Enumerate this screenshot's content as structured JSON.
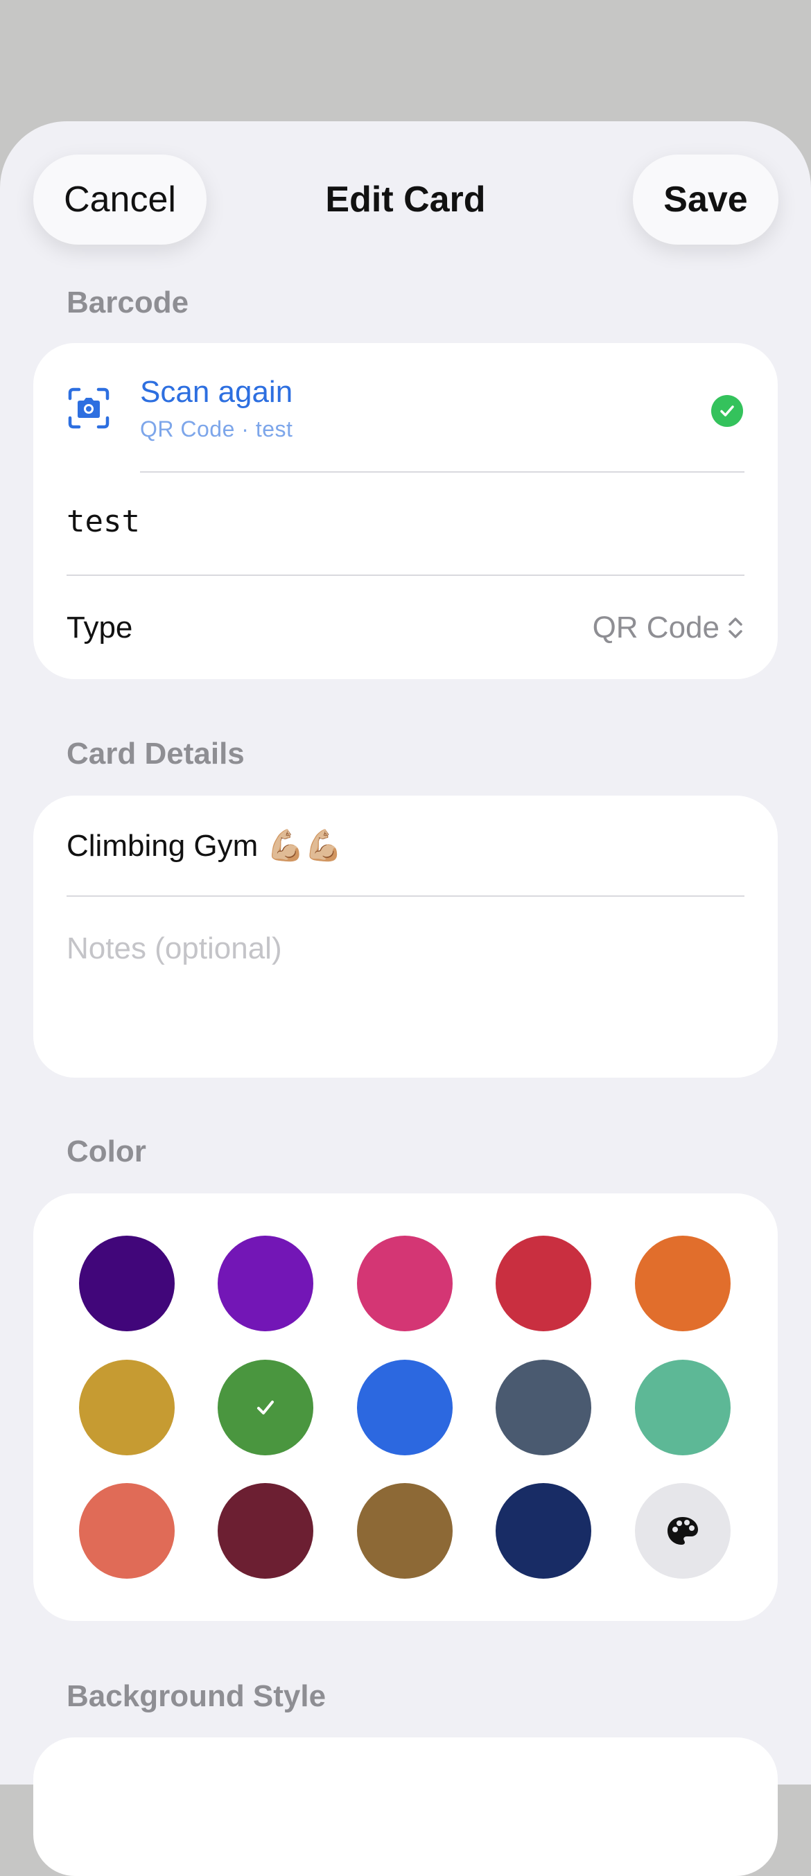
{
  "header": {
    "cancel_label": "Cancel",
    "title": "Edit Card",
    "save_label": "Save"
  },
  "barcode": {
    "section_label": "Barcode",
    "scan_label": "Scan again",
    "scan_subtitle": "QR Code · test",
    "value": "test",
    "type_label": "Type",
    "type_value": "QR Code"
  },
  "details": {
    "section_label": "Card Details",
    "name": "Climbing Gym 💪🏼💪🏼",
    "notes_placeholder": "Notes (optional)"
  },
  "color": {
    "section_label": "Color",
    "swatches": [
      {
        "hex": "#41067a"
      },
      {
        "hex": "#7316b6"
      },
      {
        "hex": "#d43674"
      },
      {
        "hex": "#c92f40"
      },
      {
        "hex": "#e16e2c"
      },
      {
        "hex": "#c69b32"
      },
      {
        "hex": "#4a963f",
        "selected": true
      },
      {
        "hex": "#2c68e0"
      },
      {
        "hex": "#4a5a70"
      },
      {
        "hex": "#5db896"
      },
      {
        "hex": "#e06b57"
      },
      {
        "hex": "#6c1f32"
      },
      {
        "hex": "#8d6936"
      },
      {
        "hex": "#182c65"
      },
      {
        "hex": "#e6e6ea",
        "custom": true,
        "icon": "palette-icon"
      }
    ]
  },
  "background": {
    "section_label": "Background Style"
  }
}
